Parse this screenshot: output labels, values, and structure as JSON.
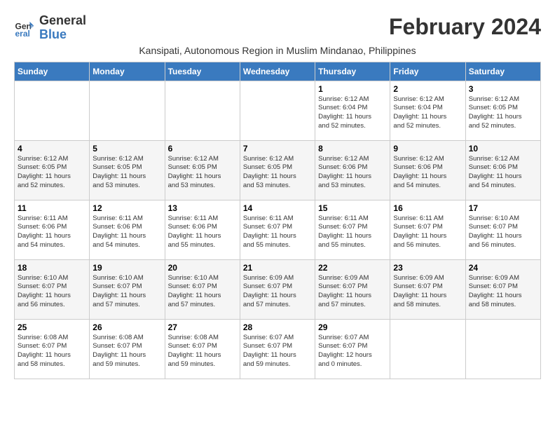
{
  "logo": {
    "line1": "General",
    "line2": "Blue"
  },
  "title": "February 2024",
  "subtitle": "Kansipati, Autonomous Region in Muslim Mindanao, Philippines",
  "days_header": [
    "Sunday",
    "Monday",
    "Tuesday",
    "Wednesday",
    "Thursday",
    "Friday",
    "Saturday"
  ],
  "weeks": [
    [
      {
        "day": "",
        "info": ""
      },
      {
        "day": "",
        "info": ""
      },
      {
        "day": "",
        "info": ""
      },
      {
        "day": "",
        "info": ""
      },
      {
        "day": "1",
        "info": "Sunrise: 6:12 AM\nSunset: 6:04 PM\nDaylight: 11 hours\nand 52 minutes."
      },
      {
        "day": "2",
        "info": "Sunrise: 6:12 AM\nSunset: 6:04 PM\nDaylight: 11 hours\nand 52 minutes."
      },
      {
        "day": "3",
        "info": "Sunrise: 6:12 AM\nSunset: 6:05 PM\nDaylight: 11 hours\nand 52 minutes."
      }
    ],
    [
      {
        "day": "4",
        "info": "Sunrise: 6:12 AM\nSunset: 6:05 PM\nDaylight: 11 hours\nand 52 minutes."
      },
      {
        "day": "5",
        "info": "Sunrise: 6:12 AM\nSunset: 6:05 PM\nDaylight: 11 hours\nand 53 minutes."
      },
      {
        "day": "6",
        "info": "Sunrise: 6:12 AM\nSunset: 6:05 PM\nDaylight: 11 hours\nand 53 minutes."
      },
      {
        "day": "7",
        "info": "Sunrise: 6:12 AM\nSunset: 6:05 PM\nDaylight: 11 hours\nand 53 minutes."
      },
      {
        "day": "8",
        "info": "Sunrise: 6:12 AM\nSunset: 6:06 PM\nDaylight: 11 hours\nand 53 minutes."
      },
      {
        "day": "9",
        "info": "Sunrise: 6:12 AM\nSunset: 6:06 PM\nDaylight: 11 hours\nand 54 minutes."
      },
      {
        "day": "10",
        "info": "Sunrise: 6:12 AM\nSunset: 6:06 PM\nDaylight: 11 hours\nand 54 minutes."
      }
    ],
    [
      {
        "day": "11",
        "info": "Sunrise: 6:11 AM\nSunset: 6:06 PM\nDaylight: 11 hours\nand 54 minutes."
      },
      {
        "day": "12",
        "info": "Sunrise: 6:11 AM\nSunset: 6:06 PM\nDaylight: 11 hours\nand 54 minutes."
      },
      {
        "day": "13",
        "info": "Sunrise: 6:11 AM\nSunset: 6:06 PM\nDaylight: 11 hours\nand 55 minutes."
      },
      {
        "day": "14",
        "info": "Sunrise: 6:11 AM\nSunset: 6:07 PM\nDaylight: 11 hours\nand 55 minutes."
      },
      {
        "day": "15",
        "info": "Sunrise: 6:11 AM\nSunset: 6:07 PM\nDaylight: 11 hours\nand 55 minutes."
      },
      {
        "day": "16",
        "info": "Sunrise: 6:11 AM\nSunset: 6:07 PM\nDaylight: 11 hours\nand 56 minutes."
      },
      {
        "day": "17",
        "info": "Sunrise: 6:10 AM\nSunset: 6:07 PM\nDaylight: 11 hours\nand 56 minutes."
      }
    ],
    [
      {
        "day": "18",
        "info": "Sunrise: 6:10 AM\nSunset: 6:07 PM\nDaylight: 11 hours\nand 56 minutes."
      },
      {
        "day": "19",
        "info": "Sunrise: 6:10 AM\nSunset: 6:07 PM\nDaylight: 11 hours\nand 57 minutes."
      },
      {
        "day": "20",
        "info": "Sunrise: 6:10 AM\nSunset: 6:07 PM\nDaylight: 11 hours\nand 57 minutes."
      },
      {
        "day": "21",
        "info": "Sunrise: 6:09 AM\nSunset: 6:07 PM\nDaylight: 11 hours\nand 57 minutes."
      },
      {
        "day": "22",
        "info": "Sunrise: 6:09 AM\nSunset: 6:07 PM\nDaylight: 11 hours\nand 57 minutes."
      },
      {
        "day": "23",
        "info": "Sunrise: 6:09 AM\nSunset: 6:07 PM\nDaylight: 11 hours\nand 58 minutes."
      },
      {
        "day": "24",
        "info": "Sunrise: 6:09 AM\nSunset: 6:07 PM\nDaylight: 11 hours\nand 58 minutes."
      }
    ],
    [
      {
        "day": "25",
        "info": "Sunrise: 6:08 AM\nSunset: 6:07 PM\nDaylight: 11 hours\nand 58 minutes."
      },
      {
        "day": "26",
        "info": "Sunrise: 6:08 AM\nSunset: 6:07 PM\nDaylight: 11 hours\nand 59 minutes."
      },
      {
        "day": "27",
        "info": "Sunrise: 6:08 AM\nSunset: 6:07 PM\nDaylight: 11 hours\nand 59 minutes."
      },
      {
        "day": "28",
        "info": "Sunrise: 6:07 AM\nSunset: 6:07 PM\nDaylight: 11 hours\nand 59 minutes."
      },
      {
        "day": "29",
        "info": "Sunrise: 6:07 AM\nSunset: 6:07 PM\nDaylight: 12 hours\nand 0 minutes."
      },
      {
        "day": "",
        "info": ""
      },
      {
        "day": "",
        "info": ""
      }
    ]
  ]
}
